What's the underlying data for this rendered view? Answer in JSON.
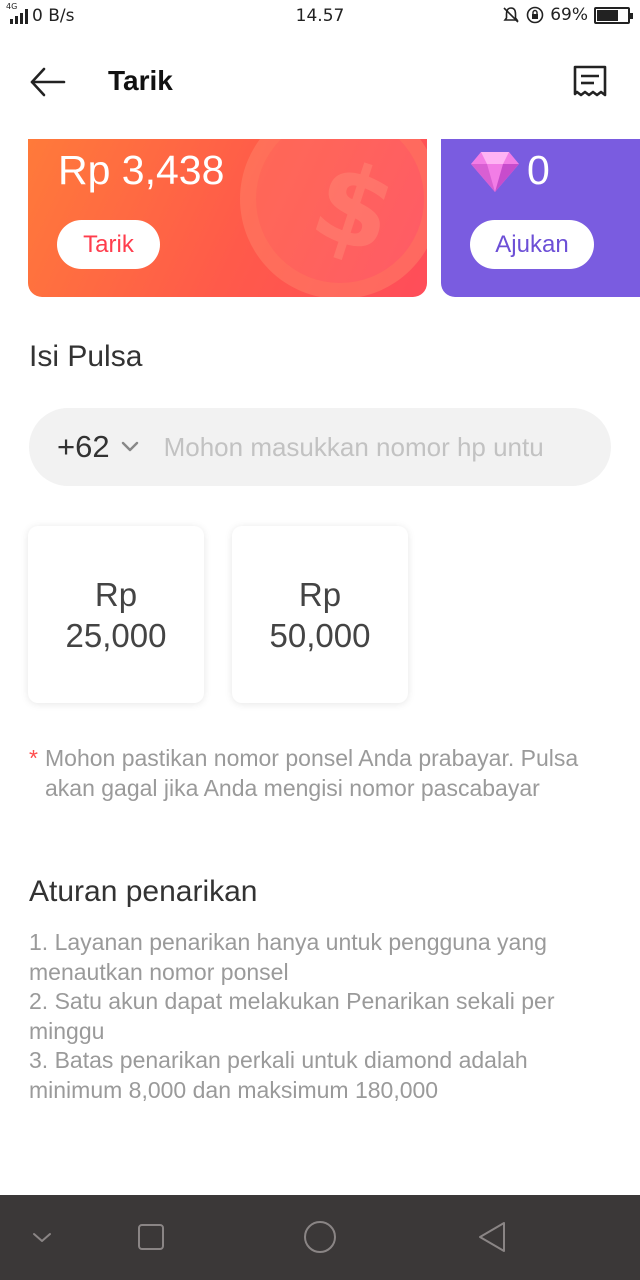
{
  "status_bar": {
    "network": "4G",
    "speed": "0 B/s",
    "time": "14.57",
    "battery": "69%",
    "battery_level": 0.69
  },
  "header": {
    "title": "Tarik",
    "back_icon": "arrow-left-icon",
    "history_icon": "receipt-icon"
  },
  "cash_card": {
    "amount": "Rp 3,438",
    "button_label": "Tarik",
    "color": "#ff5a4a"
  },
  "diamond_card": {
    "count": "0",
    "button_label": "Ajukan",
    "icon": "diamond-icon",
    "color": "#7a5ce0"
  },
  "pulsa": {
    "title": "Isi Pulsa",
    "country_code": "+62",
    "placeholder": "Mohon masukkan nomor hp untu",
    "value": ""
  },
  "options": [
    {
      "currency": "Rp",
      "amount": "25,000"
    },
    {
      "currency": "Rp",
      "amount": "50,000"
    }
  ],
  "note": {
    "star": "*",
    "text": "Mohon pastikan nomor ponsel Anda prabayar. Pulsa akan gagal jika Anda mengisi nomor pascabayar"
  },
  "rules": {
    "title": "Aturan penarikan",
    "items": [
      "1. Layanan penarikan hanya untuk pengguna yang menautkan nomor ponsel",
      "2. Satu akun dapat melakukan Penarikan sekali per minggu",
      "3. Batas penarikan perkali untuk diamond adalah minimum 8,000 dan maksimum 180,000"
    ]
  },
  "navbar": {
    "icons": [
      "chevron-down-icon",
      "square-icon",
      "circle-icon",
      "triangle-back-icon"
    ]
  }
}
